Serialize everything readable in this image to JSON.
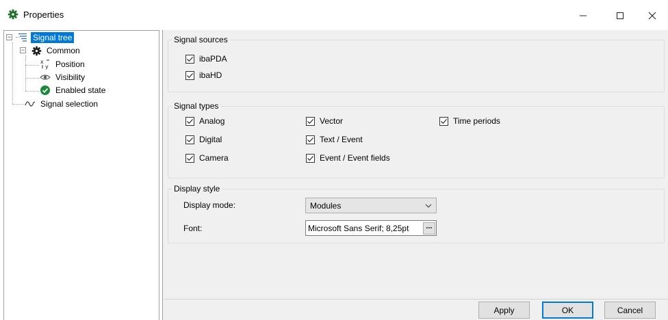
{
  "window": {
    "title": "Properties",
    "controls": {
      "minimize": "—",
      "maximize": "☐",
      "close": "✕"
    }
  },
  "tree": {
    "root": {
      "label": "Signal tree",
      "icon": "signal-tree-icon",
      "expander": "−"
    },
    "common": {
      "label": "Common",
      "icon": "gear-icon",
      "expander": "−"
    },
    "children": [
      {
        "label": "Position",
        "icon": "xy-position-icon"
      },
      {
        "label": "Visibility",
        "icon": "eye-icon"
      },
      {
        "label": "Enabled state",
        "icon": "check-circle-icon"
      }
    ],
    "signal_selection": {
      "label": "Signal selection",
      "icon": "wave-icon"
    }
  },
  "signal_sources": {
    "title": "Signal sources",
    "items": [
      {
        "label": "ibaPDA",
        "checked": true
      },
      {
        "label": "ibaHD",
        "checked": true
      }
    ]
  },
  "signal_types": {
    "title": "Signal types",
    "items": [
      {
        "label": "Analog",
        "checked": true
      },
      {
        "label": "Digital",
        "checked": true
      },
      {
        "label": "Camera",
        "checked": true
      },
      {
        "label": "Vector",
        "checked": true
      },
      {
        "label": "Text / Event",
        "checked": true
      },
      {
        "label": "Event / Event fields",
        "checked": true
      },
      {
        "label": "Time periods",
        "checked": true
      }
    ]
  },
  "display_style": {
    "title": "Display style",
    "display_mode_label": "Display mode:",
    "display_mode_value": "Modules",
    "font_label": "Font:",
    "font_value": "Microsoft Sans Serif; 8,25pt",
    "font_button": "..."
  },
  "buttons": {
    "apply": "Apply",
    "ok": "OK",
    "cancel": "Cancel"
  },
  "colors": {
    "selection": "#0078d7",
    "gear": "#1e6b2a",
    "check": "#1a8a3a"
  }
}
